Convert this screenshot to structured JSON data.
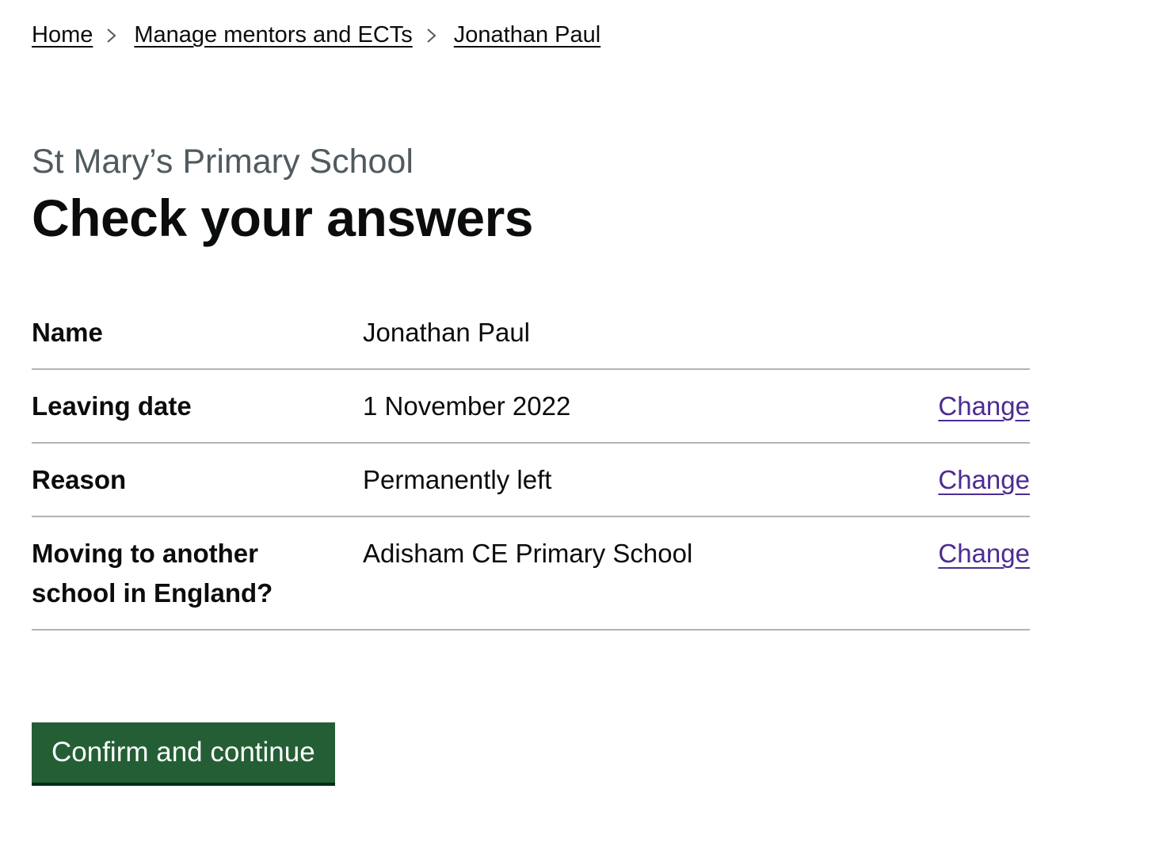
{
  "breadcrumbs": [
    {
      "label": "Home"
    },
    {
      "label": "Manage mentors and ECTs"
    },
    {
      "label": "Jonathan Paul"
    }
  ],
  "caption": "St Mary’s Primary School",
  "heading": "Check your answers",
  "summary": [
    {
      "key": "Name",
      "value": "Jonathan Paul",
      "action": ""
    },
    {
      "key": "Leaving date",
      "value": "1 November 2022",
      "action": "Change"
    },
    {
      "key": "Reason",
      "value": "Permanently left",
      "action": "Change"
    },
    {
      "key": "Moving to another school in England?",
      "value": "Adisham CE Primary School",
      "action": "Change"
    }
  ],
  "button": {
    "label": "Confirm and continue"
  },
  "colors": {
    "text": "#0b0c0c",
    "caption": "#505a5f",
    "link_visited": "#4c2c92",
    "button": "#245e35",
    "divider": "#b1b4b6"
  },
  "icons": {
    "breadcrumb_separator": "chevron-right-icon"
  }
}
